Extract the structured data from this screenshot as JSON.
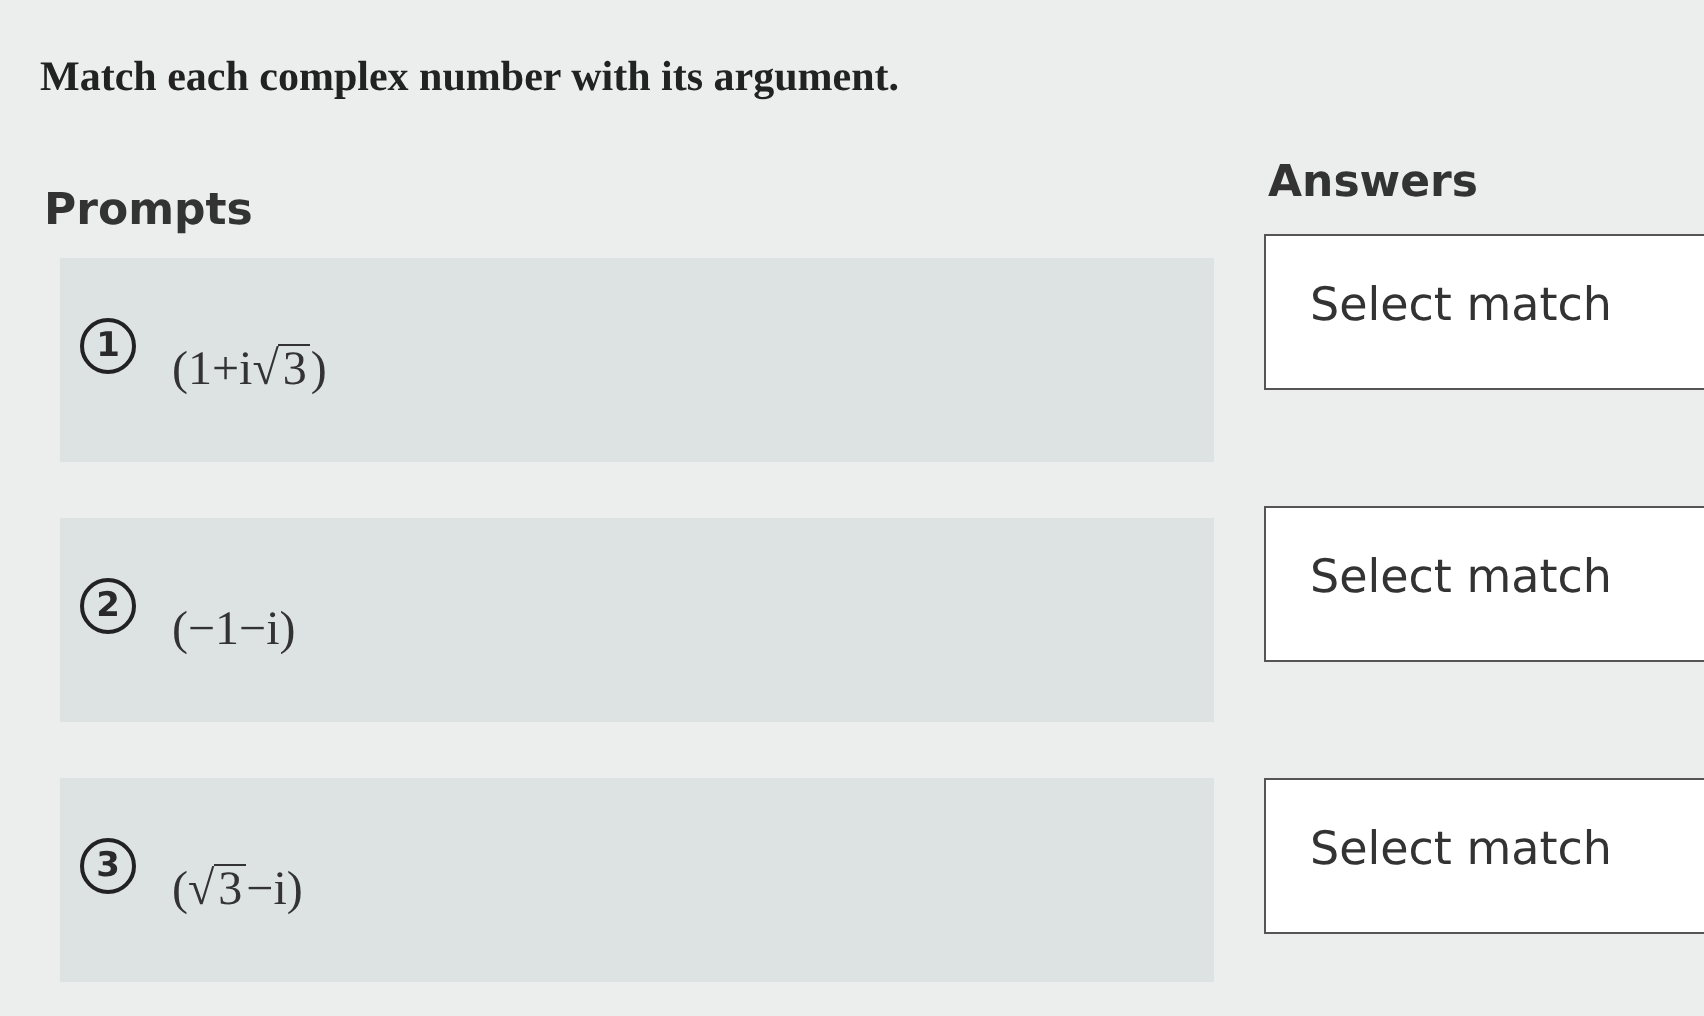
{
  "instruction": "Match each complex number with its argument.",
  "prompts_heading": "Prompts",
  "answers_heading": "Answers",
  "prompts": [
    {
      "number": "1",
      "parts": [
        {
          "kind": "text",
          "text": "(1+i"
        },
        {
          "kind": "sqrt",
          "sign": "√",
          "radicand": "3"
        },
        {
          "kind": "text",
          "text": ")"
        }
      ]
    },
    {
      "number": "2",
      "parts": [
        {
          "kind": "text",
          "text": "(−1−i)"
        }
      ]
    },
    {
      "number": "3",
      "parts": [
        {
          "kind": "text",
          "text": "("
        },
        {
          "kind": "sqrt",
          "sign": "√",
          "radicand": "3"
        },
        {
          "kind": "text",
          "text": "−i)"
        }
      ]
    }
  ],
  "answers": [
    {
      "label": "Select match"
    },
    {
      "label": "Select match"
    },
    {
      "label": "Select match"
    }
  ]
}
